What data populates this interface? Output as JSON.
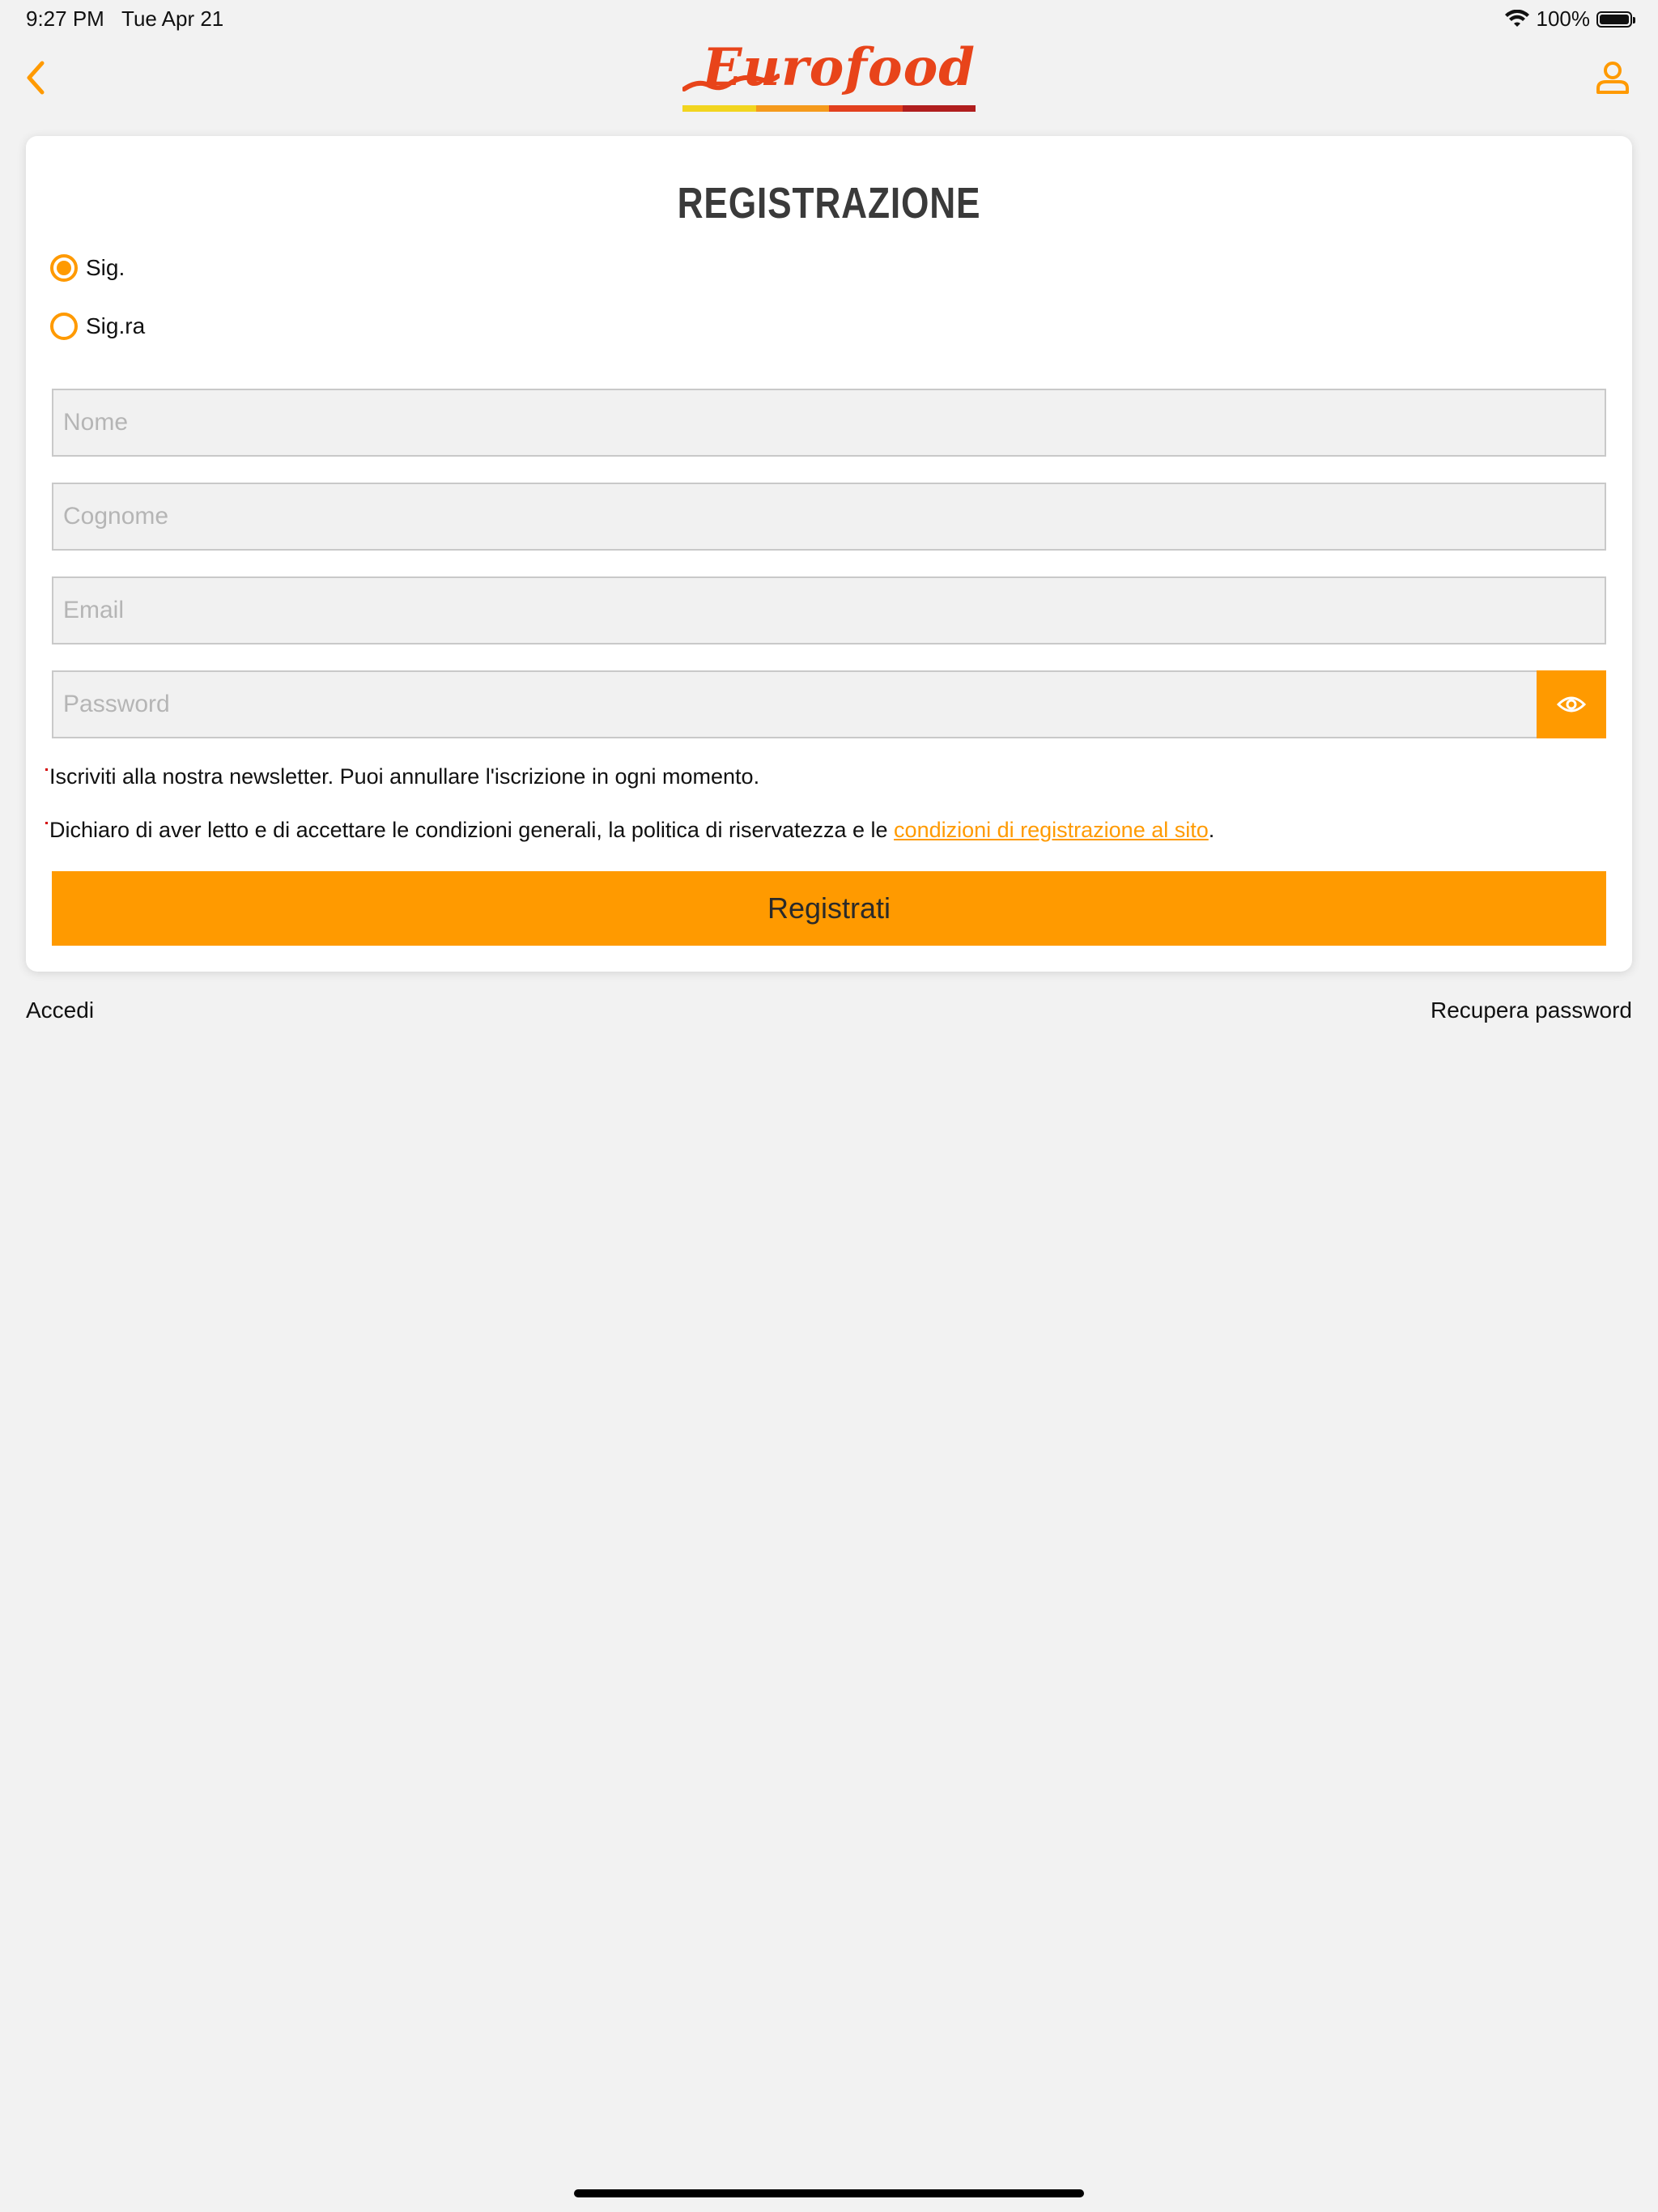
{
  "status_bar": {
    "time": "9:27 PM   Tue Apr 21",
    "battery": "100%"
  },
  "nav": {
    "logo_text": "Eurofood",
    "stripe_colors": [
      "#f2d51f",
      "#f59a1c",
      "#e2401e",
      "#b01e1e"
    ],
    "back_icon": "chevron-left-icon",
    "profile_icon": "user-icon"
  },
  "colors": {
    "accent": "#ff9a00",
    "logo_red": "#e8441a",
    "background": "#f2f2f2"
  },
  "form": {
    "title": "REGISTRAZIONE",
    "salutations": [
      {
        "label": "Sig.",
        "selected": true
      },
      {
        "label": "Sig.ra",
        "selected": false
      }
    ],
    "fields": {
      "first_name": {
        "placeholder": "Nome",
        "value": ""
      },
      "last_name": {
        "placeholder": "Cognome",
        "value": ""
      },
      "email": {
        "placeholder": "Email",
        "value": ""
      },
      "password": {
        "placeholder": "Password",
        "value": ""
      }
    },
    "newsletter_text": "Iscriviti alla nostra newsletter. Puoi annullare l'iscrizione in ogni momento.",
    "terms_text": "Dichiaro di aver letto e di accettare le condizioni generali, la politica di riservatezza e le ",
    "terms_link": "condizioni di registrazione al sito",
    "terms_end": ".",
    "submit_label": "Registrati"
  },
  "footer": {
    "login_label": "Accedi",
    "recover_label": "Recupera password"
  }
}
